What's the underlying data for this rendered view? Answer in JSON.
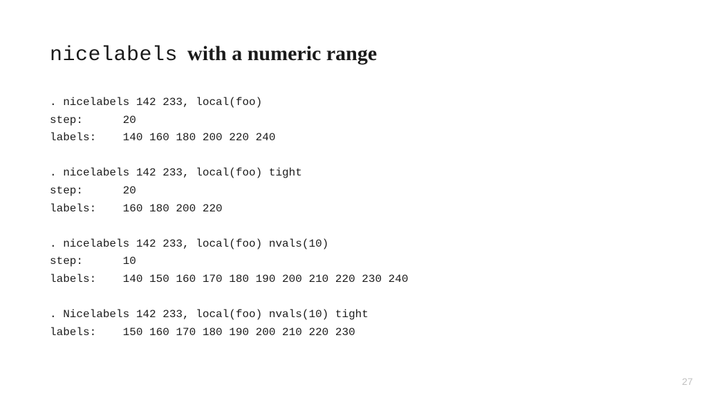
{
  "title": {
    "command": "nicelabels",
    "rest": "with a numeric range"
  },
  "code": ". nicelabels 142 233, local(foo)\nstep:      20\nlabels:    140 160 180 200 220 240\n\n. nicelabels 142 233, local(foo) tight\nstep:      20\nlabels:    160 180 200 220\n\n. nicelabels 142 233, local(foo) nvals(10)\nstep:      10\nlabels:    140 150 160 170 180 190 200 210 220 230 240\n\n. Nicelabels 142 233, local(foo) nvals(10) tight\nlabels:    150 160 170 180 190 200 210 220 230",
  "page_number": "27"
}
